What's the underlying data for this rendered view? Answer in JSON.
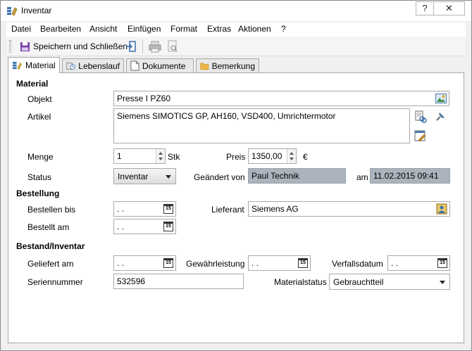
{
  "window": {
    "title": "Inventar",
    "help_label": "?",
    "close_label": "✕"
  },
  "menu": [
    "Datei",
    "Bearbeiten",
    "Ansicht",
    "Einfügen",
    "Format",
    "Extras",
    "Aktionen",
    "?"
  ],
  "toolbar": {
    "save_close_label": "Speichern und Schließen"
  },
  "tabs": [
    "Material",
    "Lebenslauf",
    "Dokumente",
    "Bemerkung"
  ],
  "sections": {
    "material": "Material",
    "bestellung": "Bestellung",
    "bestand": "Bestand/Inventar"
  },
  "labels": {
    "objekt": "Objekt",
    "artikel": "Artikel",
    "menge": "Menge",
    "stk": "Stk",
    "preis": "Preis",
    "euro": "€",
    "status": "Status",
    "geaendert_von": "Geändert von",
    "am": "am",
    "bestellen_bis": "Bestellen bis",
    "lieferant": "Lieferant",
    "bestellt_am": "Bestellt am",
    "geliefert_am": "Geliefert am",
    "gewaehrleistung": "Gewährleistung",
    "verfallsdatum": "Verfallsdatum",
    "seriennummer": "Seriennummer",
    "materialstatus": "Materialstatus"
  },
  "values": {
    "objekt": "Presse I PZ60",
    "artikel": "Siemens SIMOTICS GP, AH160, VSD400, Umrichtermotor",
    "menge": "1",
    "preis": "1350,00",
    "status": "Inventar",
    "geaendert_von": "Paul Technik",
    "geaendert_am": "11.02.2015 09:41",
    "bestellen_bis": " .  .",
    "lieferant": "Siemens AG",
    "bestellt_am": " .  .",
    "geliefert_am": " .  .",
    "gewaehrleistung": " .  .",
    "verfallsdatum": " .  .",
    "seriennummer": "532596",
    "materialstatus": "Gebrauchtteil",
    "calendar_glyph": "15"
  }
}
